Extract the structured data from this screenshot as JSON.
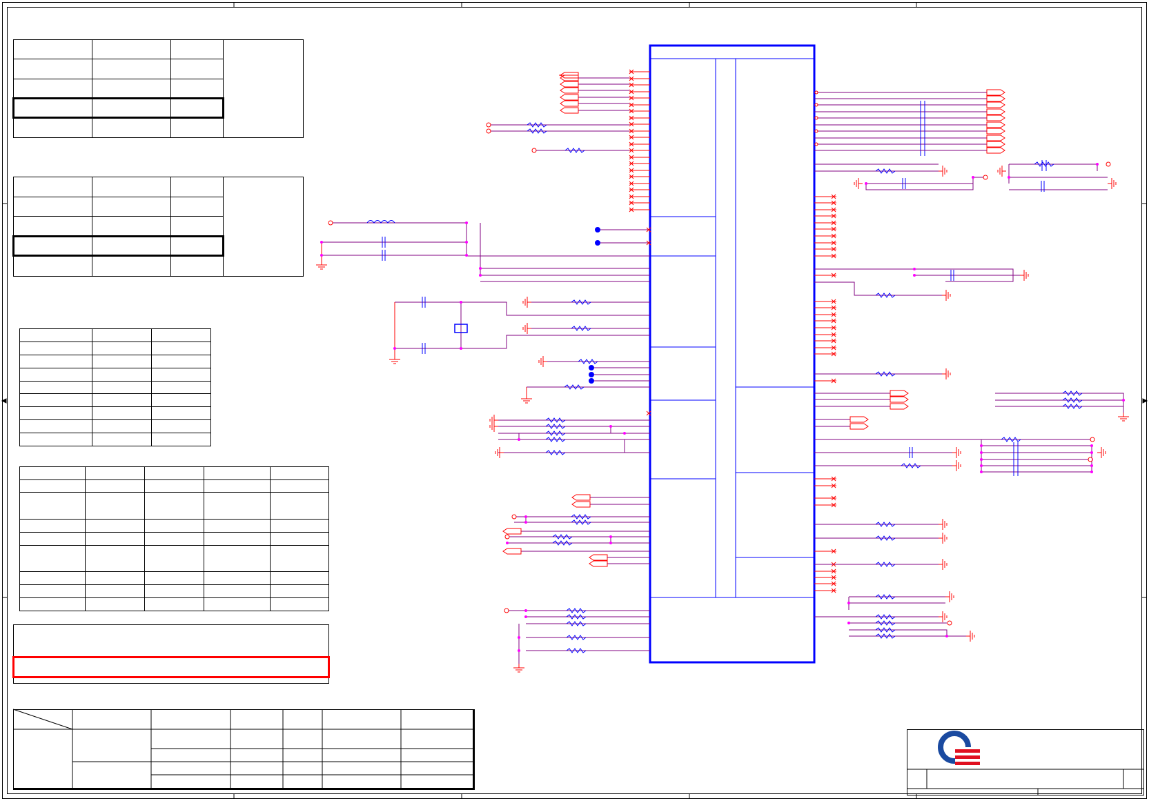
{
  "colors": {
    "frame": "#000000",
    "wire": "#ff0000",
    "net": "#800080",
    "component": "#0000ff",
    "junction": "#ff00ff",
    "logo_blue": "#1a4aa0",
    "logo_red": "#e01020"
  },
  "logo": {
    "icon": "company-logo-icon"
  }
}
